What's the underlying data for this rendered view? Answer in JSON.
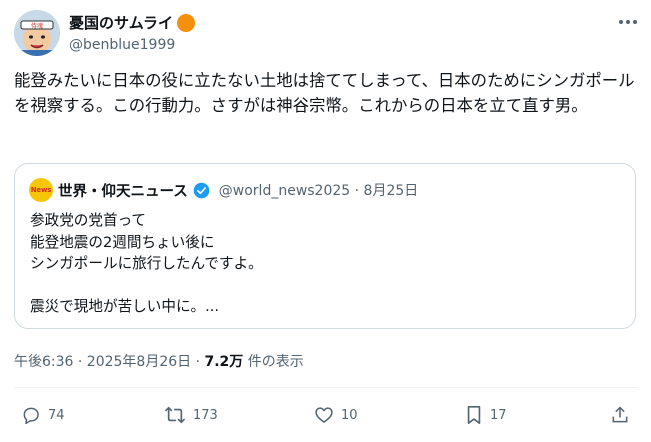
{
  "author": {
    "name": "憂国のサムライ",
    "handle": "@benblue1999",
    "avatar_text": "侍魂",
    "badge_color": "#f4900c"
  },
  "tweet": {
    "text": "能登みたいに日本の役に立たない土地は捨ててしまって、日本のためにシンガポールを視察する。この行動力。さすがは神谷宗幣。これからの日本を立て直す男。"
  },
  "quote": {
    "avatar_text": "News",
    "name": "世界・仰天ニュース",
    "meta": "@world_news2025 · 8月25日",
    "text": "参政党の党首って\n能登地震の2週間ちょい後に\nシンガポールに旅行したんですよ。\n\n震災で現地が苦しい中に。..."
  },
  "meta": {
    "time": "午後6:36 · 2025年8月26日 · ",
    "views": "7.2万",
    "views_label": " 件の表示"
  },
  "actions": {
    "replies": "74",
    "reposts": "173",
    "likes": "10",
    "bookmarks": "17"
  },
  "colors": {
    "text": "#0f1419",
    "secondary": "#536471",
    "verified": "#1d9bf0",
    "border": "#cfd9de"
  },
  "icons": [
    "more-icon",
    "reply-icon",
    "repost-icon",
    "like-icon",
    "bookmark-icon",
    "share-icon",
    "verified-icon"
  ]
}
